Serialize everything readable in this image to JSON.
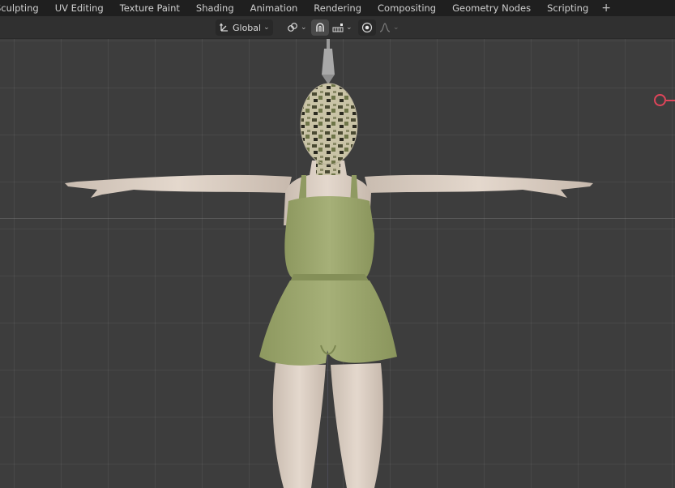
{
  "workspace_tabs": [
    {
      "label": "Sculpting"
    },
    {
      "label": "UV Editing"
    },
    {
      "label": "Texture Paint"
    },
    {
      "label": "Shading"
    },
    {
      "label": "Animation"
    },
    {
      "label": "Rendering"
    },
    {
      "label": "Compositing"
    },
    {
      "label": "Geometry Nodes"
    },
    {
      "label": "Scripting"
    }
  ],
  "add_tab_label": "+",
  "viewport_header": {
    "transform_orientation": "Global",
    "icons": {
      "orientation": "transform-orientation-icon",
      "pivot": "pivot-point-icon",
      "snap": "snap-magnet-icon",
      "snap_target": "snap-increment-icon",
      "proportional": "proportional-editing-icon",
      "falloff": "falloff-curve-icon"
    }
  },
  "colors": {
    "topbar": "#1f1f1f",
    "header": "#303030",
    "viewport": "#3d3d3d",
    "gizmo_x_axis": "#e0455a",
    "skin": "#ddd0c4",
    "romper": "#9ea970"
  }
}
